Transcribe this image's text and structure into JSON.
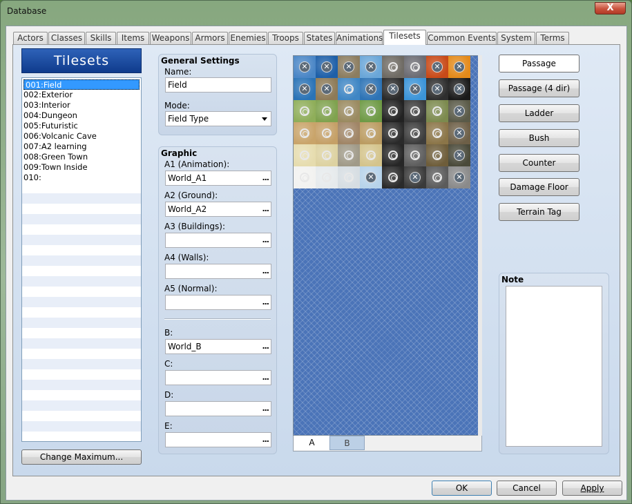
{
  "window": {
    "title": "Database",
    "close_glyph": "X"
  },
  "tabs": [
    "Actors",
    "Classes",
    "Skills",
    "Items",
    "Weapons",
    "Armors",
    "Enemies",
    "Troops",
    "States",
    "Animations",
    "Tilesets",
    "Common Events",
    "System",
    "Terms"
  ],
  "active_tab": "Tilesets",
  "left_panel": {
    "header": "Tilesets",
    "items": [
      "001:Field",
      "002:Exterior",
      "003:Interior",
      "004:Dungeon",
      "005:Futuristic",
      "006:Volcanic Cave",
      "007:A2 learning",
      "008:Green Town",
      "009:Town Inside",
      "010:"
    ],
    "selected_index": 0,
    "change_max_label": "Change Maximum..."
  },
  "general": {
    "title": "General Settings",
    "name_label": "Name:",
    "name_value": "Field",
    "mode_label": "Mode:",
    "mode_value": "Field Type"
  },
  "graphic": {
    "title": "Graphic",
    "slots": [
      {
        "label": "A1 (Animation):",
        "value": "World_A1"
      },
      {
        "label": "A2 (Ground):",
        "value": "World_A2"
      },
      {
        "label": "A3 (Buildings):",
        "value": ""
      },
      {
        "label": "A4 (Walls):",
        "value": ""
      },
      {
        "label": "A5 (Normal):",
        "value": ""
      },
      {
        "label": "B:",
        "value": "World_B"
      },
      {
        "label": "C:",
        "value": ""
      },
      {
        "label": "D:",
        "value": ""
      },
      {
        "label": "E:",
        "value": ""
      }
    ],
    "browse_glyph": "..."
  },
  "palette_tabs": [
    "A",
    "B"
  ],
  "palette_active_tab": "A",
  "passage_buttons": [
    "Passage",
    "Passage (4 dir)",
    "Ladder",
    "Bush",
    "Counter",
    "Damage Floor",
    "Terrain Tag"
  ],
  "note": {
    "title": "Note",
    "value": ""
  },
  "footer": {
    "ok": "OK",
    "cancel": "Cancel",
    "apply": "Apply"
  },
  "tiles": [
    {
      "bg": "#4a86c6",
      "m": "x"
    },
    {
      "bg": "#1d5fa8",
      "m": "x"
    },
    {
      "bg": "#8c7d60",
      "m": "x"
    },
    {
      "bg": "#6aa6d8",
      "m": "x"
    },
    {
      "bg": "#6e6a63",
      "m": "o"
    },
    {
      "bg": "#6b6b72",
      "m": "o"
    },
    {
      "bg": "#c84a18",
      "m": "x"
    },
    {
      "bg": "#e48a1a",
      "m": "x"
    },
    {
      "bg": "#2a73b6",
      "m": "x"
    },
    {
      "bg": "#8d7a57",
      "m": "x"
    },
    {
      "bg": "#3f86c4",
      "m": "o"
    },
    {
      "bg": "#2d73b5",
      "m": "x"
    },
    {
      "bg": "#2a2a2a",
      "m": "x"
    },
    {
      "bg": "#3b94d8",
      "m": "x"
    },
    {
      "bg": "#2e2e2e",
      "m": "x"
    },
    {
      "bg": "#1a1a1a",
      "m": "x"
    },
    {
      "bg": "#8fae5a",
      "m": "o"
    },
    {
      "bg": "#7fa24e",
      "m": "o"
    },
    {
      "bg": "#9a8a60",
      "m": "o"
    },
    {
      "bg": "#6e9a45",
      "m": "o"
    },
    {
      "bg": "#222222",
      "m": "o"
    },
    {
      "bg": "#3a3a3a",
      "m": "o"
    },
    {
      "bg": "#7c8a4e",
      "m": "o"
    },
    {
      "bg": "#5a5a48",
      "m": "x"
    },
    {
      "bg": "#c9a46a",
      "m": "o"
    },
    {
      "bg": "#c5a067",
      "m": "o"
    },
    {
      "bg": "#a08566",
      "m": "o"
    },
    {
      "bg": "#bb9c62",
      "m": "o"
    },
    {
      "bg": "#2a2a2a",
      "m": "o"
    },
    {
      "bg": "#3c3c3c",
      "m": "o"
    },
    {
      "bg": "#8b7548",
      "m": "o"
    },
    {
      "bg": "#6d5f47",
      "m": "x"
    },
    {
      "bg": "#e6dcae",
      "m": "o"
    },
    {
      "bg": "#ddd2a1",
      "m": "o"
    },
    {
      "bg": "#a09a88",
      "m": "o"
    },
    {
      "bg": "#d4c48c",
      "m": "o"
    },
    {
      "bg": "#262626",
      "m": "o"
    },
    {
      "bg": "#5d5d5d",
      "m": "o"
    },
    {
      "bg": "#6e5d3a",
      "m": "o"
    },
    {
      "bg": "#4a4a3a",
      "m": "x"
    },
    {
      "bg": "#f2f2f0",
      "m": "o"
    },
    {
      "bg": "#e6eaec",
      "m": "o"
    },
    {
      "bg": "#d6dde2",
      "m": "o"
    },
    {
      "bg": "#b7d3ea",
      "m": "x"
    },
    {
      "bg": "#2a2a2a",
      "m": "o"
    },
    {
      "bg": "#3a3a3a",
      "m": "x"
    },
    {
      "bg": "#5b5b5b",
      "m": "o"
    },
    {
      "bg": "#8a8a8a",
      "m": "x"
    }
  ]
}
